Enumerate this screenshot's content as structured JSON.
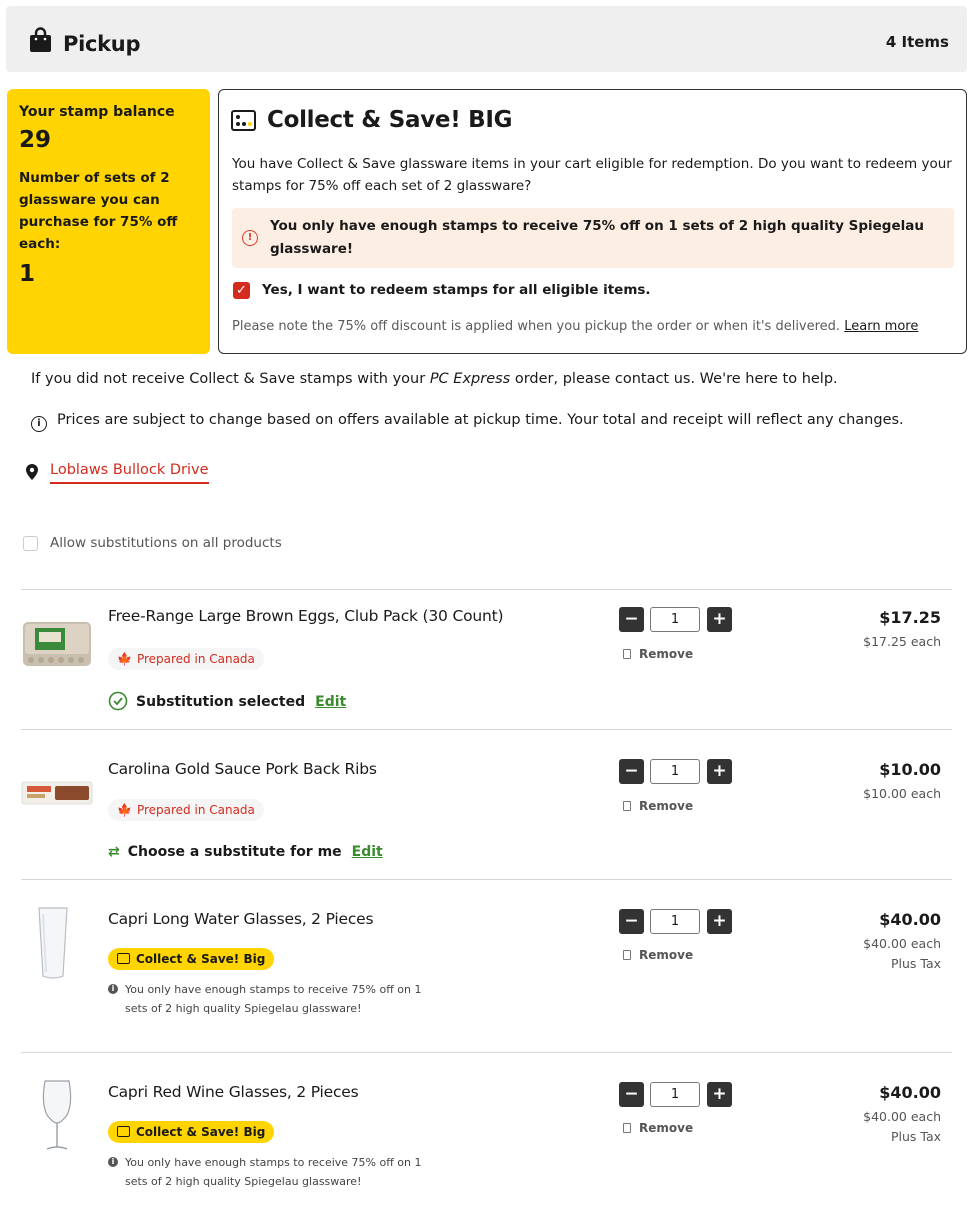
{
  "header": {
    "title": "Pickup",
    "item_count": "4 Items"
  },
  "stamps": {
    "balance_label": "Your stamp balance",
    "balance": "29",
    "sets_label": "Number of sets of 2 glassware you can purchase for 75% off each:",
    "sets": "1"
  },
  "collect_save": {
    "title": "Collect & Save! BIG",
    "description": "You have Collect & Save glassware items in your cart eligible for redemption. Do you want to redeem your stamps for 75% off each set of 2 glassware?",
    "warning": "You only have enough stamps to receive 75% off on 1 sets of 2 high quality Spiegelau glassware!",
    "redeem_label": "Yes, I want to redeem stamps for all eligible items.",
    "redeem_checked": true,
    "note": "Please note the 75% off discount is applied when you pickup the order or when it's delivered.",
    "learn_more": "Learn more"
  },
  "contact": {
    "prefix": "If you did not receive Collect & Save stamps with your ",
    "brand": "PC Express",
    "suffix": " order, please contact us. We're here to help."
  },
  "prices_notice": "Prices are subject to change based on offers available at pickup time. Your total and receipt will reflect any changes.",
  "store": {
    "name": "Loblaws Bullock Drive"
  },
  "substitutions": {
    "label": "Allow substitutions on all products",
    "checked": false
  },
  "items": [
    {
      "name": "Free-Range Large Brown Eggs, Club Pack (30 Count)",
      "badge": "Prepared in Canada",
      "sub_status": "Substitution selected",
      "edit": "Edit",
      "qty": "1",
      "remove": "Remove",
      "total": "$17.25",
      "each": "$17.25 each"
    },
    {
      "name": "Carolina Gold Sauce Pork Back Ribs",
      "badge": "Prepared in Canada",
      "sub_status": "Choose a substitute for me",
      "edit": "Edit",
      "qty": "1",
      "remove": "Remove",
      "total": "$10.00",
      "each": "$10.00 each"
    },
    {
      "name": "Capri Long Water Glasses, 2 Pieces",
      "badge": "Collect & Save! Big",
      "note": "You only have enough stamps to receive 75% off on 1 sets of 2 high quality Spiegelau glassware!",
      "qty": "1",
      "remove": "Remove",
      "total": "$40.00",
      "each": "$40.00 each",
      "tax": "Plus Tax"
    },
    {
      "name": "Capri Red Wine Glasses, 2 Pieces",
      "badge": "Collect & Save! Big",
      "note": "You only have enough stamps to receive 75% off on 1 sets of 2 high quality Spiegelau glassware!",
      "qty": "1",
      "remove": "Remove",
      "total": "$40.00",
      "each": "$40.00 each",
      "tax": "Plus Tax"
    }
  ],
  "colors": {
    "brand_yellow": "#ffd400",
    "accent_red": "#d42b1e",
    "edit_green": "#3a8b2e"
  }
}
